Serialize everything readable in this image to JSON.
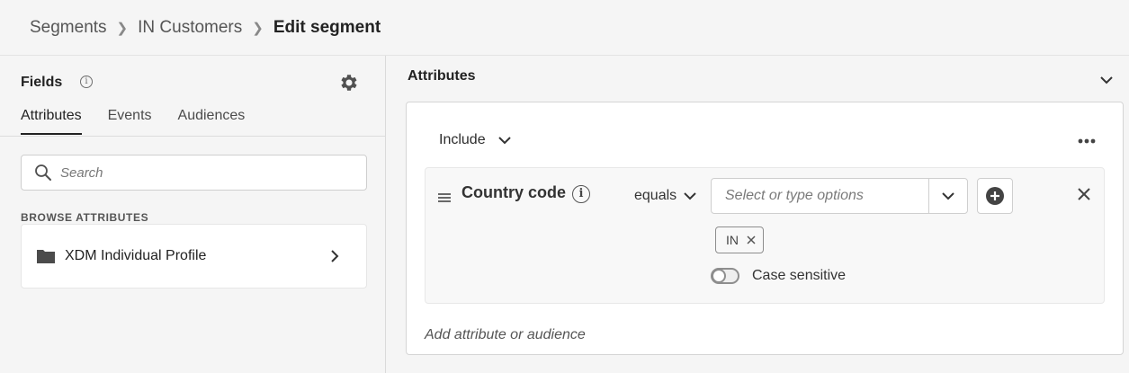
{
  "breadcrumb": {
    "items": [
      "Segments",
      "IN Customers"
    ],
    "current": "Edit segment"
  },
  "left_panel": {
    "title": "Fields",
    "tabs": [
      {
        "label": "Attributes",
        "active": true
      },
      {
        "label": "Events",
        "active": false
      },
      {
        "label": "Audiences",
        "active": false
      }
    ],
    "search": {
      "placeholder": "Search",
      "value": ""
    },
    "browse_label": "BROWSE ATTRIBUTES",
    "browse_items": [
      {
        "label": "XDM Individual Profile",
        "icon": "folder-icon"
      }
    ]
  },
  "right_panel": {
    "header": "Attributes",
    "rule": {
      "include_label": "Include",
      "condition": {
        "field": "Country code",
        "operator": "equals",
        "value_placeholder": "Select or type options",
        "value_input": "",
        "tags": [
          "IN"
        ],
        "case_sensitive_label": "Case sensitive",
        "case_sensitive": false
      },
      "add_link": "Add attribute or audience"
    }
  },
  "colors": {
    "background": "#f5f5f5",
    "card": "#ffffff",
    "border": "#d5d5d5",
    "text": "#2c2c2c"
  }
}
